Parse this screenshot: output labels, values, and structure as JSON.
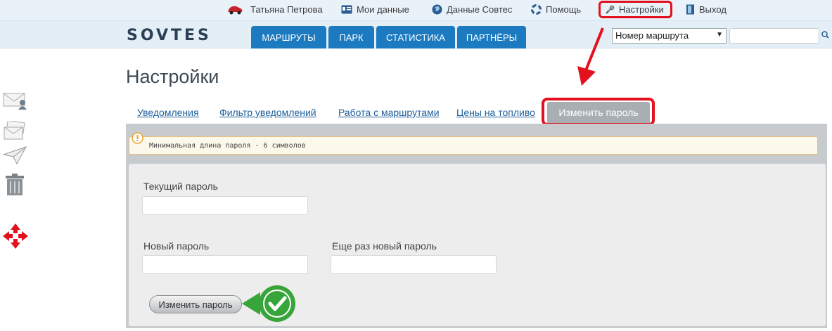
{
  "topbar": {
    "user_name": "Татьяна Петрова",
    "my_data": "Мои данные",
    "company_data": "Данные Совтес",
    "help": "Помощь",
    "settings": "Настройки",
    "logout": "Выход"
  },
  "header": {
    "logo_text": "SOVTES",
    "tabs": [
      {
        "label": "МАРШРУТЫ"
      },
      {
        "label": "ПАРК"
      },
      {
        "label": "СТАТИСТИКА"
      },
      {
        "label": "ПАРТНЁРЫ"
      }
    ],
    "search_select": "Номер маршрута",
    "search_value": ""
  },
  "sidebar": {
    "icons": [
      "mail-person-icon",
      "envelopes-icon",
      "paper-plane-icon",
      "trash-icon",
      "move-arrows-icon"
    ]
  },
  "page": {
    "title": "Настройки",
    "subtabs": [
      {
        "label": "Уведомления"
      },
      {
        "label": "Фильтр уведомлений"
      },
      {
        "label": "Работа с маршрутами"
      },
      {
        "label": "Цены на топливо"
      },
      {
        "label": "Изменить пароль",
        "active": true
      }
    ],
    "notice": "Минимальная длина пароля - 6 символов",
    "form": {
      "current_password_label": "Текущий пароль",
      "current_password_value": "",
      "new_password_label": "Новый пароль",
      "new_password_value": "",
      "repeat_password_label": "Еще раз новый пароль",
      "repeat_password_value": "",
      "submit_label": "Изменить пароль"
    }
  },
  "colors": {
    "tab_blue": "#1b7ac0",
    "highlight_red": "#e3101d",
    "check_green": "#37a53a",
    "link_blue": "#1d5f9a"
  }
}
